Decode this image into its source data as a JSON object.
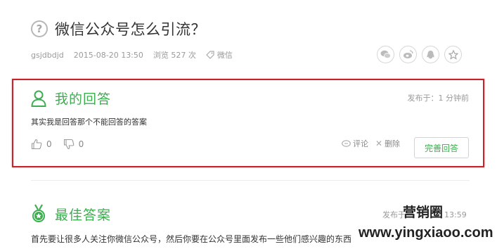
{
  "question": {
    "icon": "question-circle-icon",
    "title": "微信公众号怎么引流？",
    "author": "gsjdbdjd",
    "datetime": "2015-08-20 13:50",
    "views": "浏览 527 次",
    "tag": "微信"
  },
  "share": {
    "icons": [
      "wechat-icon",
      "weibo-icon",
      "qq-icon",
      "star-icon"
    ]
  },
  "my_answer": {
    "title": "我的回答",
    "published": "发布于：1 分钟前",
    "text": "其实我是回答那个不能回答的答案",
    "likes": "0",
    "dislikes": "0",
    "comment_label": "评论",
    "delete_label": "删除",
    "complete_button": "完善回答"
  },
  "best_answer": {
    "title": "最佳答案",
    "published": "发布于：",
    "published_tail": "13:59",
    "text": "首先要让很多人关注你微信公众号，然后你要在公众号里面发布一些他们感兴趣的东西"
  },
  "watermark": {
    "name": "营销圈",
    "url": "www.yingxiaoo.com"
  },
  "colors": {
    "accent_green": "#3cae50",
    "highlight_red": "#c8222a"
  }
}
